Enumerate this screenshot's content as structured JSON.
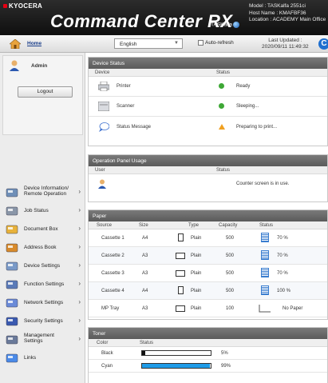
{
  "header": {
    "brand": "KYOCERA",
    "product": "Command Center RX",
    "model_logo": "TASKalfa",
    "model": "Model : TASKalfa 2551ci",
    "host": "Host Name : KMAFBF36",
    "location": "Location : ACADEMY Main Office"
  },
  "toolbar": {
    "home": "Home",
    "language": "English",
    "auto_refresh": "Auto-refresh",
    "last_updated_label": "Last Updated :",
    "last_updated_value": "2020/09/11 11:49:32",
    "refresh_icon": "refresh-icon"
  },
  "sidebar": {
    "user": "Admin",
    "logout": "Logout",
    "items": [
      {
        "label": "Device Information/ Remote Operation",
        "icon": "device-info-icon",
        "two_line": true
      },
      {
        "label": "Job Status",
        "icon": "job-status-icon"
      },
      {
        "label": "Document Box",
        "icon": "document-box-icon"
      },
      {
        "label": "Address Book",
        "icon": "address-book-icon"
      },
      {
        "label": "Device Settings",
        "icon": "device-settings-icon"
      },
      {
        "label": "Function Settings",
        "icon": "function-settings-icon"
      },
      {
        "label": "Network Settings",
        "icon": "network-settings-icon"
      },
      {
        "label": "Security Settings",
        "icon": "security-settings-icon"
      },
      {
        "label": "Management Settings",
        "icon": "management-settings-icon",
        "two_line": true
      },
      {
        "label": "Links",
        "icon": "links-icon"
      }
    ]
  },
  "device_status": {
    "title": "Device Status",
    "col_device": "Device",
    "col_status": "Status",
    "rows": [
      {
        "device": "Printer",
        "status": "Ready",
        "indicator": "green"
      },
      {
        "device": "Scanner",
        "status": "Sleeping...",
        "indicator": "green"
      },
      {
        "device": "Status Message",
        "status": "Preparing to print...",
        "indicator": "warning"
      }
    ]
  },
  "op_panel": {
    "title": "Operation Panel Usage",
    "col_user": "User",
    "col_status": "Status",
    "status": "Counter screen is in use."
  },
  "paper": {
    "title": "Paper",
    "columns": [
      "Source",
      "Size",
      "Type",
      "Capacity",
      "Status"
    ],
    "rows": [
      {
        "source": "Cassette 1",
        "size": "A4",
        "type": "Plain",
        "capacity": "500",
        "status": "70 %",
        "orient": "portrait",
        "level": 0.7
      },
      {
        "source": "Cassette 2",
        "size": "A3",
        "type": "Plain",
        "capacity": "500",
        "status": "70 %",
        "orient": "landscape",
        "level": 0.7
      },
      {
        "source": "Cassette 3",
        "size": "A3",
        "type": "Plain",
        "capacity": "500",
        "status": "70 %",
        "orient": "landscape",
        "level": 0.7
      },
      {
        "source": "Cassette 4",
        "size": "A4",
        "type": "Plain",
        "capacity": "500",
        "status": "100 %",
        "orient": "portrait",
        "level": 1.0
      },
      {
        "source": "MP Tray",
        "size": "A3",
        "type": "Plain",
        "capacity": "100",
        "status": "No Paper",
        "orient": "landscape",
        "level": 0
      }
    ]
  },
  "toner": {
    "title": "Toner",
    "col_color": "Color",
    "col_status": "Status",
    "rows": [
      {
        "color": "Black",
        "percent": "5%",
        "level": 0.05,
        "fill": "#111111"
      },
      {
        "color": "Cyan",
        "percent": "99%",
        "level": 0.99,
        "fill": "#1e9be8"
      }
    ]
  }
}
